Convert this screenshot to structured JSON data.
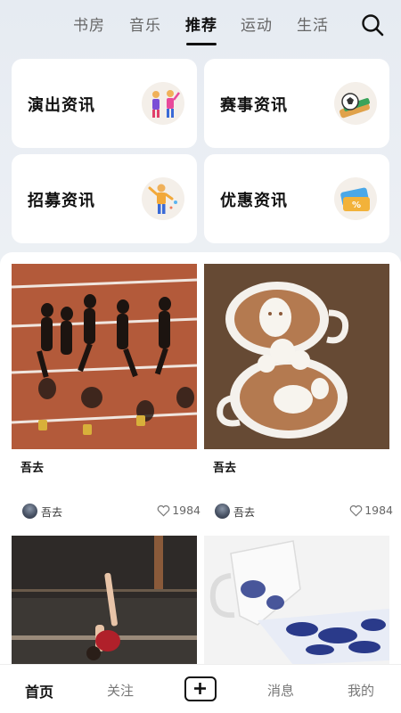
{
  "top_tabs": [
    "书房",
    "音乐",
    "推荐",
    "运动",
    "生活"
  ],
  "active_tab": "推荐",
  "cards": [
    {
      "label": "演出资讯",
      "icon": "performers-icon"
    },
    {
      "label": "赛事资讯",
      "icon": "soccer-ball-icon"
    },
    {
      "label": "招募资讯",
      "icon": "recruit-person-icon"
    },
    {
      "label": "优惠资讯",
      "icon": "coupon-ticket-icon"
    }
  ],
  "posts": [
    {
      "title": "吾去",
      "author": "吾去",
      "likes": "1984",
      "image": "running-silhouettes-photo"
    },
    {
      "title": "吾去",
      "author": "吾去",
      "likes": "1984",
      "image": "latte-art-cups-photo"
    },
    {
      "image": "gymnast-photo"
    },
    {
      "image": "porcelain-cup-photo"
    }
  ],
  "bottom_nav": {
    "home": "首页",
    "follow": "关注",
    "messages": "消息",
    "mine": "我的"
  },
  "colors": {
    "accent": "#111111",
    "background": "#eef1f5"
  }
}
